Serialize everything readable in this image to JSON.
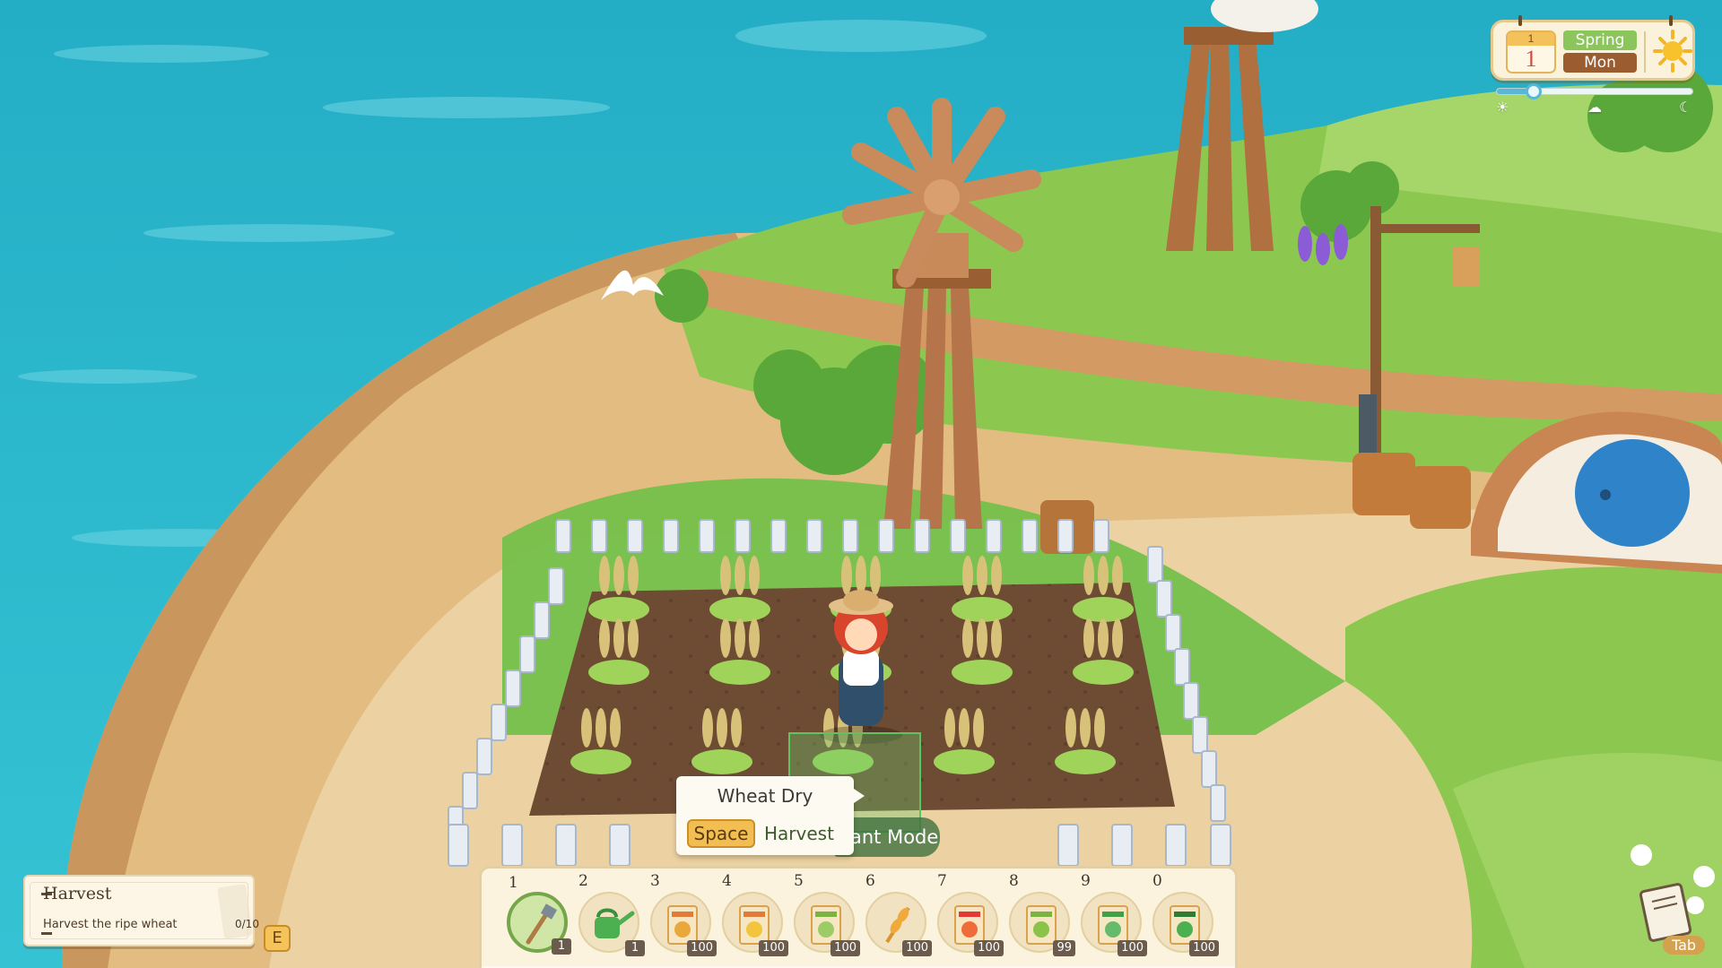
{
  "hud": {
    "calendar_month": "1",
    "calendar_day": "1",
    "season": "Spring",
    "weekday": "Mon",
    "weather_icon": "sun-icon",
    "time_progress": 0.19,
    "time_icons": [
      "sunrise-icon",
      "sunset-icon",
      "moon-icon"
    ]
  },
  "quest": {
    "title": "Harvest",
    "description": "Harvest the ripe wheat",
    "progress": "0/10",
    "key_label": "E"
  },
  "tooltip": {
    "title": "Wheat Dry",
    "key": "Space",
    "action": "Harvest"
  },
  "mode": {
    "label": "ant Mode"
  },
  "hotbar": {
    "slots": [
      {
        "num": "1",
        "count": "1",
        "item": "hoe-icon",
        "selected": true
      },
      {
        "num": "2",
        "count": "1",
        "item": "watering-can-icon"
      },
      {
        "num": "3",
        "count": "100",
        "item": "seed-packet-icon"
      },
      {
        "num": "4",
        "count": "100",
        "item": "seed-packet-icon"
      },
      {
        "num": "5",
        "count": "100",
        "item": "seed-packet-icon"
      },
      {
        "num": "6",
        "count": "100",
        "item": "wheat-icon"
      },
      {
        "num": "7",
        "count": "100",
        "item": "seed-packet-icon"
      },
      {
        "num": "8",
        "count": "99",
        "item": "seed-packet-icon"
      },
      {
        "num": "9",
        "count": "100",
        "item": "seed-packet-icon"
      },
      {
        "num": "0",
        "count": "100",
        "item": "seed-packet-icon"
      }
    ]
  },
  "journal": {
    "key_label": "Tab",
    "icon": "journal-icon"
  },
  "colors": {
    "sea": "#2bb3c7",
    "grass": "#8cc84f",
    "sand": "#e8c590",
    "soil": "#6b4a33",
    "panel_bg": "#fbf3de",
    "season_green": "#8cc55c",
    "weekday_brown": "#9b5c2f",
    "key_yellow": "#f2be52"
  }
}
